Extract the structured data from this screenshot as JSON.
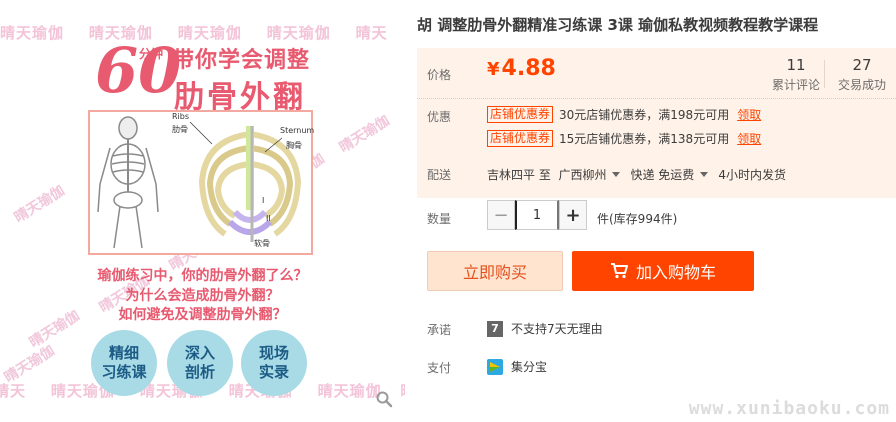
{
  "gallery": {
    "watermark_text": "晴天瑜伽",
    "watermark_fragments": {
      "left": "晴天瑜伽",
      "right": "晴天"
    },
    "watermark_fragments_bottom": {
      "left": "晴天",
      "right": "晴"
    },
    "poster": {
      "big_number": "60",
      "minutes": "分钟",
      "headline_1": "带你学会调整",
      "headline_2": "肋骨外翻",
      "labels": {
        "ribs": "Ribs",
        "ribs_cn": "肋骨",
        "sternum": "Sternum",
        "sternum_cn": "胸骨",
        "cartilage": "软骨",
        "roman_one": "I",
        "roman_two": "II"
      },
      "questions": [
        "瑜伽练习中，你的肋骨外翻了么？",
        "为什么会造成肋骨外翻？",
        "如何避免及调整肋骨外翻？"
      ],
      "circles": [
        {
          "line1": "精细",
          "line2": "习练课"
        },
        {
          "line1": "深入",
          "line2": "剖析"
        },
        {
          "line1": "现场",
          "line2": "实录"
        }
      ]
    }
  },
  "product": {
    "title": "胡 调整肋骨外翻精准习练课 3课 瑜伽私教视频教程教学课程",
    "price_label": "价格",
    "price_symbol": "¥",
    "price_value": "4.88",
    "reviews_count": "11",
    "reviews_label": "累计评论",
    "sales_count": "27",
    "sales_label": "交易成功",
    "promo_label": "优惠",
    "coupons": [
      {
        "tag": "店铺优惠券",
        "text": "30元店铺优惠券，满198元可用",
        "link": "领取"
      },
      {
        "tag": "店铺优惠券",
        "text": "15元店铺优惠券，满138元可用",
        "link": "领取"
      }
    ],
    "shipping_label": "配送",
    "ship_from": "吉林四平 至",
    "ship_to": "广西柳州",
    "ship_method": "快递 免运费",
    "ship_time": "4小时内发货",
    "quantity_label": "数量",
    "quantity_value": "1",
    "quantity_minus": "−",
    "quantity_plus": "+",
    "stock_text": "件(库存994件)",
    "buy_now_label": "立即购买",
    "add_to_cart_label": "加入购物车",
    "promise_label": "承诺",
    "promise_text": "不支持7天无理由",
    "promise_badge": "7",
    "payment_label": "支付",
    "payment_text": "集分宝"
  },
  "site_watermark": "www.xunibaoku.com",
  "colors": {
    "accent": "#ff4400",
    "price": "#ff4400",
    "price_bg": "#fff2e8",
    "poster_pink": "#e85a6f",
    "circle_blue": "#a9dbe6"
  },
  "icons": [
    "magnifier-icon",
    "cart-icon",
    "caret-down-icon",
    "promise-7-icon",
    "jifenbao-icon"
  ]
}
